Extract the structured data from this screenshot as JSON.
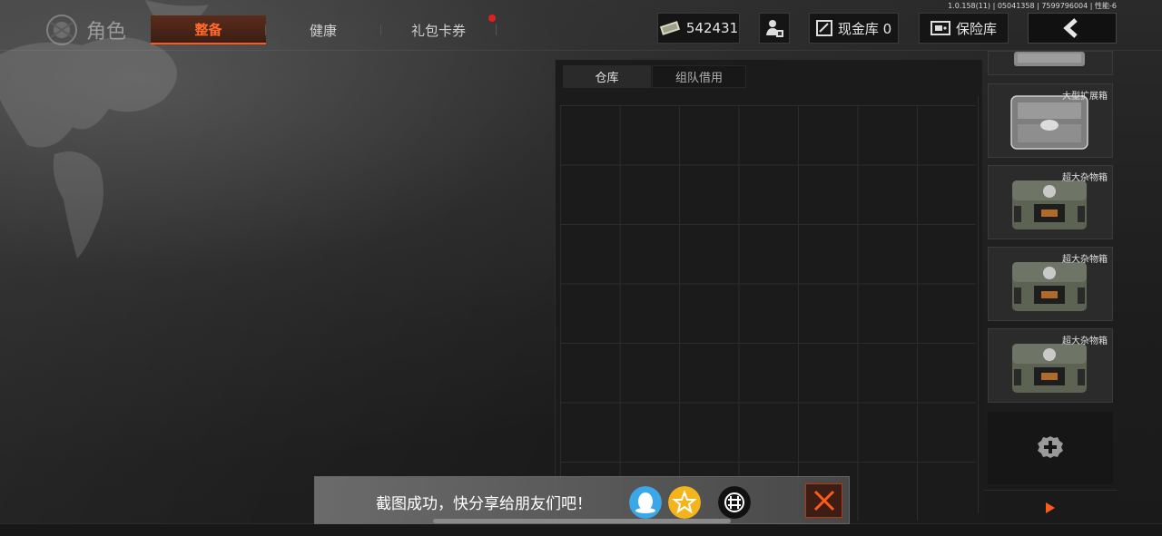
{
  "version": "1.0.158(11) | 05041358 | 7599796004 | 性能-6",
  "header": {
    "title": "角色",
    "tabs": [
      {
        "label": "整备",
        "active": true
      },
      {
        "label": "健康",
        "active": false
      },
      {
        "label": "礼包卡券",
        "active": false,
        "notification": true
      }
    ],
    "currency": "542431",
    "cash_vault": "现金库 0",
    "safe_box": "保险库"
  },
  "warehouse": {
    "tabs": [
      {
        "label": "仓库",
        "active": true
      },
      {
        "label": "组队借用",
        "active": false
      }
    ]
  },
  "containers": [
    {
      "label": "大型扩展箱",
      "icon": "metal-case-icon"
    },
    {
      "label": "超大杂物箱",
      "icon": "camo-crate-icon"
    },
    {
      "label": "超大杂物箱",
      "icon": "camo-crate-icon"
    },
    {
      "label": "超大杂物箱",
      "icon": "camo-crate-icon"
    }
  ],
  "toast": {
    "message": "截图成功，快分享给朋友们吧！",
    "share_icons": [
      "qq-icon",
      "qzone-icon",
      "wechat-icon"
    ]
  },
  "colors": {
    "accent": "#ff5a1a",
    "notification": "#e02020",
    "qq": "#3aa7e8",
    "qzone": "#f4b51c"
  }
}
